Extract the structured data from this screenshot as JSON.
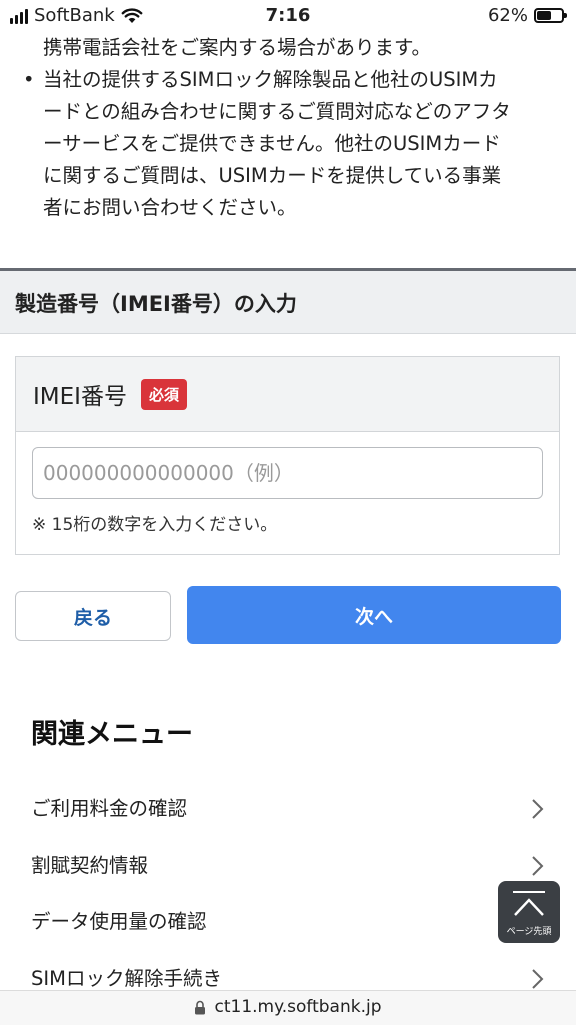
{
  "status_bar": {
    "carrier": "SoftBank",
    "time": "7:16",
    "battery_percent": "62%",
    "battery_level": 0.62
  },
  "notes": {
    "continuation": "携帯電話会社をご案内する場合があります。",
    "bullet_symbol": "•",
    "bullet_lines": [
      "当社の提供するSIMロック解除製品と他社のUSIMカ",
      "ードとの組み合わせに関するご質問対応などのアフタ",
      "ーサービスをご提供できません。他社のUSIMカード",
      "に関するご質問は、USIMカードを提供している事業",
      "者にお問い合わせください。"
    ]
  },
  "section_header": "製造番号（IMEI番号）の入力",
  "imei": {
    "label": "IMEI番号",
    "required_badge": "必須",
    "placeholder": "000000000000000（例）",
    "value": "",
    "hint": "※ 15桁の数字を入力ください。"
  },
  "buttons": {
    "back": "戻る",
    "next": "次へ"
  },
  "related_menu": {
    "title": "関連メニュー",
    "items": [
      {
        "label": "ご利用料金の確認"
      },
      {
        "label": "割賦契約情報"
      },
      {
        "label": "データ使用量の確認"
      },
      {
        "label": "SIMロック解除手続き"
      }
    ]
  },
  "page_top": {
    "label": "ページ先頭",
    "icon": "arrow-up-icon"
  },
  "url_bar": {
    "url": "ct11.my.softbank.jp",
    "icon": "lock-icon"
  },
  "colors": {
    "primary_button": "#4286ee",
    "back_text": "#1f5ea8",
    "required_badge": "#d9343a",
    "header_bg": "#eef0f2"
  }
}
